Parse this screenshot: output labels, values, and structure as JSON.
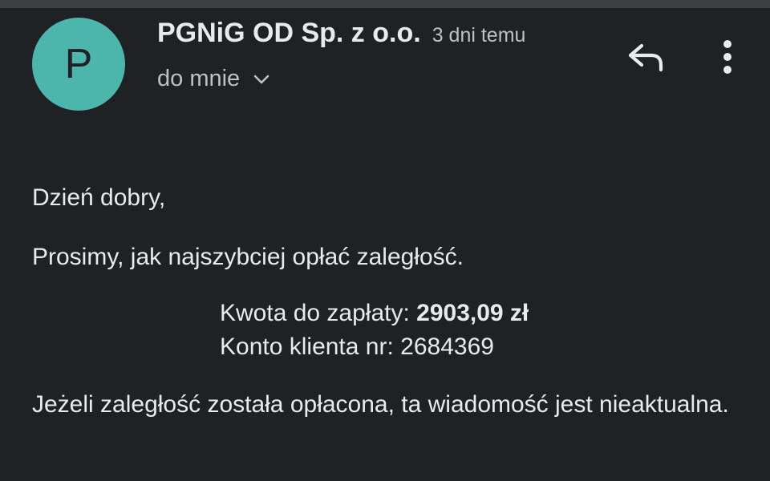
{
  "header": {
    "avatar_letter": "P",
    "avatar_color": "#4db6ac",
    "sender": "PGNiG OD Sp. z o.o.",
    "timestamp": "3 dni temu",
    "recipient": "do mnie",
    "icons": [
      "chevron-down-icon",
      "reply-icon",
      "more-vert-icon"
    ]
  },
  "message": {
    "greeting": "Dzień dobry,",
    "request": "Prosimy, jak najszybciej opłać zaległość.",
    "amount_label": "Kwota do zapłaty:",
    "amount_value": "2903,09 zł",
    "account_label": "Konto klienta nr:",
    "account_number": "2684369",
    "note": "Jeżeli zaległość została opłacona, ta wiadomość jest nieaktualna."
  },
  "colors": {
    "background": "#202124",
    "text_primary": "#e8eaed",
    "text_secondary": "#bdc1c6"
  }
}
